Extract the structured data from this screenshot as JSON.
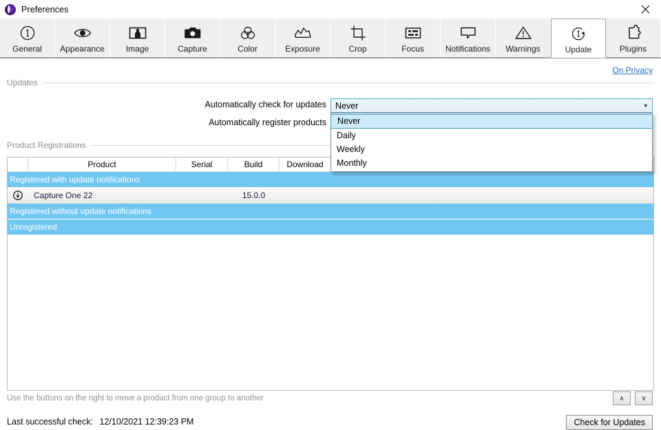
{
  "window": {
    "title": "Preferences",
    "app_icon": "capture-one-logo-icon",
    "close_label": "×"
  },
  "tabs": [
    {
      "label": "General",
      "icon": "circled-one-icon"
    },
    {
      "label": "Appearance",
      "icon": "eye-icon"
    },
    {
      "label": "Image",
      "icon": "picture-icon"
    },
    {
      "label": "Capture",
      "icon": "camera-icon"
    },
    {
      "label": "Color",
      "icon": "color-circles-icon"
    },
    {
      "label": "Exposure",
      "icon": "histogram-icon"
    },
    {
      "label": "Crop",
      "icon": "crop-icon"
    },
    {
      "label": "Focus",
      "icon": "focus-grid-icon"
    },
    {
      "label": "Notifications",
      "icon": "speech-bubble-icon"
    },
    {
      "label": "Warnings",
      "icon": "warning-triangle-icon"
    },
    {
      "label": "Update",
      "icon": "update-refresh-icon",
      "selected": true
    },
    {
      "label": "Plugins",
      "icon": "puzzle-piece-icon"
    }
  ],
  "links": {
    "privacy": "On Privacy"
  },
  "sections": {
    "updates_title": "Updates",
    "registrations_title": "Product Registrations"
  },
  "form": {
    "auto_check_label": "Automatically check for updates",
    "auto_register_label": "Automatically register products",
    "auto_check_value": "Never",
    "auto_check_options": [
      "Never",
      "Daily",
      "Weekly",
      "Monthly"
    ],
    "auto_check_highlighted": "Never",
    "dropdown_open": true
  },
  "table": {
    "columns": [
      "",
      "Product",
      "Serial",
      "Build",
      "Download",
      ""
    ],
    "groups": [
      {
        "label": "Registered with update notifications",
        "rows": [
          {
            "icon": "update-available-icon",
            "product": "Capture One 22",
            "serial": "",
            "build": "15.0.0",
            "download": ""
          }
        ]
      },
      {
        "label": "Registered without update notifications",
        "rows": []
      },
      {
        "label": "Unregistered",
        "rows": []
      }
    ]
  },
  "footer": {
    "hint": "Use the buttons on the right to move a product from one group to another",
    "move_up_label": "∧",
    "move_down_label": "∨",
    "last_check_label": "Last successful check:",
    "last_check_value": "12/10/2021 12:39:23 PM",
    "check_updates_label": "Check for Updates"
  },
  "colors": {
    "group_row_blue": "#72c7f2",
    "link_blue": "#1e70bf",
    "combo_border": "#5ba7d4",
    "highlight_blue": "#cdebf9"
  }
}
